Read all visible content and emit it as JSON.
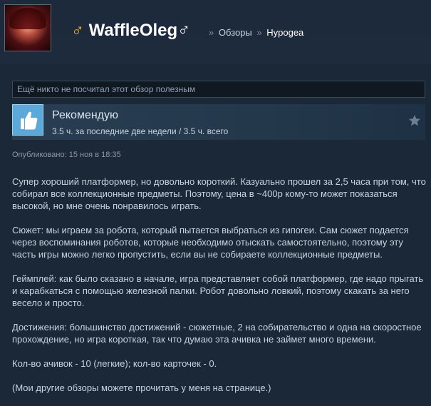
{
  "header": {
    "username": "WaffleOleg",
    "symbol_prefix": "♂",
    "symbol_suffix": "♂",
    "breadcrumb_sep": "»",
    "breadcrumb_reviews": "Обзоры",
    "breadcrumb_game": "Hypogea"
  },
  "review": {
    "helpful_text": "Ещё никто не посчитал этот обзор полезным",
    "recommendation": "Рекомендую",
    "hours": "3.5 ч. за последние две недели / 3.5 ч. всего",
    "posted": "Опубликовано: 15 ноя в 18:35",
    "paragraphs": [
      "Супер хороший платформер, но довольно короткий. Казуально прошел за 2,5 часа при том, что собирал все коллекционные предметы. Поэтому, цена в ~400р кому-то может показаться высокой, но мне очень понравилось играть.",
      "Сюжет: мы играем за робота, который пытается выбраться из гипогеи. Сам сюжет подается через воспоминания роботов, которые необходимо отыскать самостоятельно, поэтому эту часть игры можно легко пропустить, если вы не собираете коллекционные предметы.",
      "Геймплей: как было сказано в начале, игра представляет собой платформер, где надо прыгать и карабкаться с помощью железной палки. Робот довольно ловкий, поэтому скакать за него весело и просто.",
      "Достижения: большинство достижений - сюжетные, 2 на собирательство и одна на скоростное прохождение, но игра короткая, так что думаю эта ачивка не займет много времени.",
      "Кол-во ачивок - 10 (легкие); кол-во карточек - 0.",
      "(Мои другие обзоры можете прочитать у меня на странице.)"
    ]
  },
  "colors": {
    "background": "#1b2838",
    "accent_symbol": "#f5b52a",
    "thumb_bg": "#5aa9d8"
  },
  "icons": {
    "thumb": "thumbs-up-icon",
    "star": "star-icon"
  }
}
